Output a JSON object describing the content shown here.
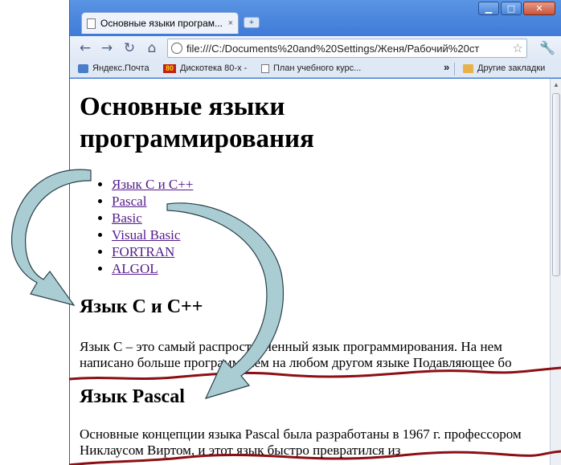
{
  "browser": {
    "tab_title": "Основные языки програм...",
    "tab_close": "×",
    "new_tab": "+",
    "window_controls": {
      "minimize": "▁",
      "maximize": "□",
      "close": "✕"
    },
    "nav": {
      "back": "←",
      "forward": "→",
      "reload": "↻",
      "home": "⌂"
    },
    "url": "file:///C:/Documents%20and%20Settings/Женя/Рабочий%20ст",
    "star": "☆",
    "menu": "🔧"
  },
  "bookmarks": {
    "items": [
      "Яндекс.Почта",
      "Дискотека 80-х -",
      "План учебного курс..."
    ],
    "disco_badge": "80",
    "overflow": "»",
    "other": "Другие закладки"
  },
  "page": {
    "title": "Основные языки программирования",
    "links": [
      "Язык С и С++",
      "Pascal",
      "Basic",
      "Visual Basic",
      "FORTRAN",
      "ALGOL"
    ],
    "section1_title": "Язык С и С++",
    "section1_text": "Язык С – это самый распространенный язык программирования. На нем написано больше программ, чем на любом другом языке Подавляющее бо",
    "section2_title": "Язык Pascal",
    "section2_text": "Основные концепции языка Pascal была разработаны в 1967 г. профессором Никлаусом Виртом, и этот язык быстро превратился из"
  },
  "colors": {
    "frame": "#3a78d6",
    "link": "#551a8b",
    "arrow_fill": "#a9cdd3",
    "tear_line": "#8b0f14"
  }
}
